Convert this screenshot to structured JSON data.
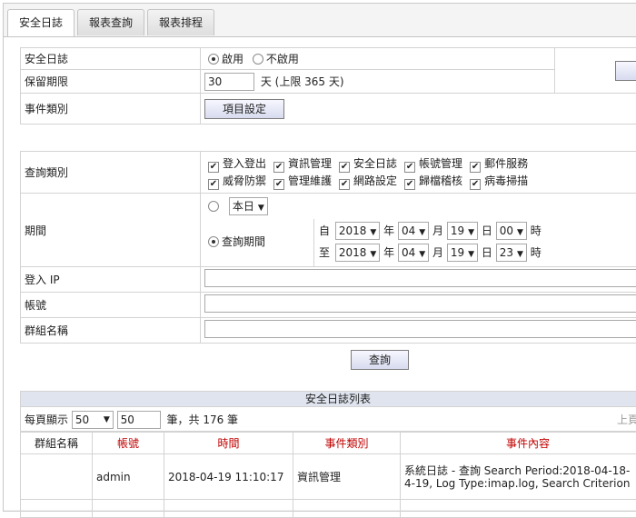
{
  "tabs": [
    "安全日誌",
    "報表查詢",
    "報表排程"
  ],
  "settings": {
    "security_log_label": "安全日誌",
    "enable_label": "啟用",
    "disable_label": "不啟用",
    "retention_label": "保留期限",
    "retention_value": "30",
    "retention_unit": "天 (上限 365 天)",
    "event_category_label": "事件類別",
    "item_settings_button": "項目設定"
  },
  "query": {
    "category_label": "查詢類別",
    "categories": [
      "登入登出",
      "資訊管理",
      "安全日誌",
      "帳號管理",
      "郵件服務",
      "威脅防禦",
      "管理維護",
      "網路設定",
      "歸檔稽核",
      "病毒掃描"
    ],
    "period_label": "期間",
    "preset_value": "本日",
    "custom_period_label": "查詢期間",
    "from_label": "自",
    "to_label": "至",
    "from": {
      "year": "2018",
      "month": "04",
      "day": "19",
      "hour": "00"
    },
    "to": {
      "year": "2018",
      "month": "04",
      "day": "19",
      "hour": "23"
    },
    "year_unit": "年",
    "month_unit": "月",
    "day_unit": "日",
    "hour_unit": "時",
    "login_ip_label": "登入 IP",
    "account_label": "帳號",
    "group_label": "群組名稱",
    "query_button": "查詢"
  },
  "list": {
    "title": "安全日誌列表",
    "per_page_label": "每頁顯示",
    "per_page_value": "50",
    "page_input_value": "50",
    "total_text": "筆，共 176 筆",
    "prev_page": "上頁",
    "columns": [
      "群組名稱",
      "帳號",
      "時間",
      "事件類別",
      "事件內容"
    ],
    "rows": [
      {
        "group": "",
        "account": "admin",
        "time": "2018-04-19 11:10:17",
        "category": "資訊管理",
        "content_line1": "系統日誌 - 查詢 Search Period:2018-04-18-",
        "content_line2": "4-19, Log Type:imap.log, Search Criterion"
      }
    ]
  }
}
